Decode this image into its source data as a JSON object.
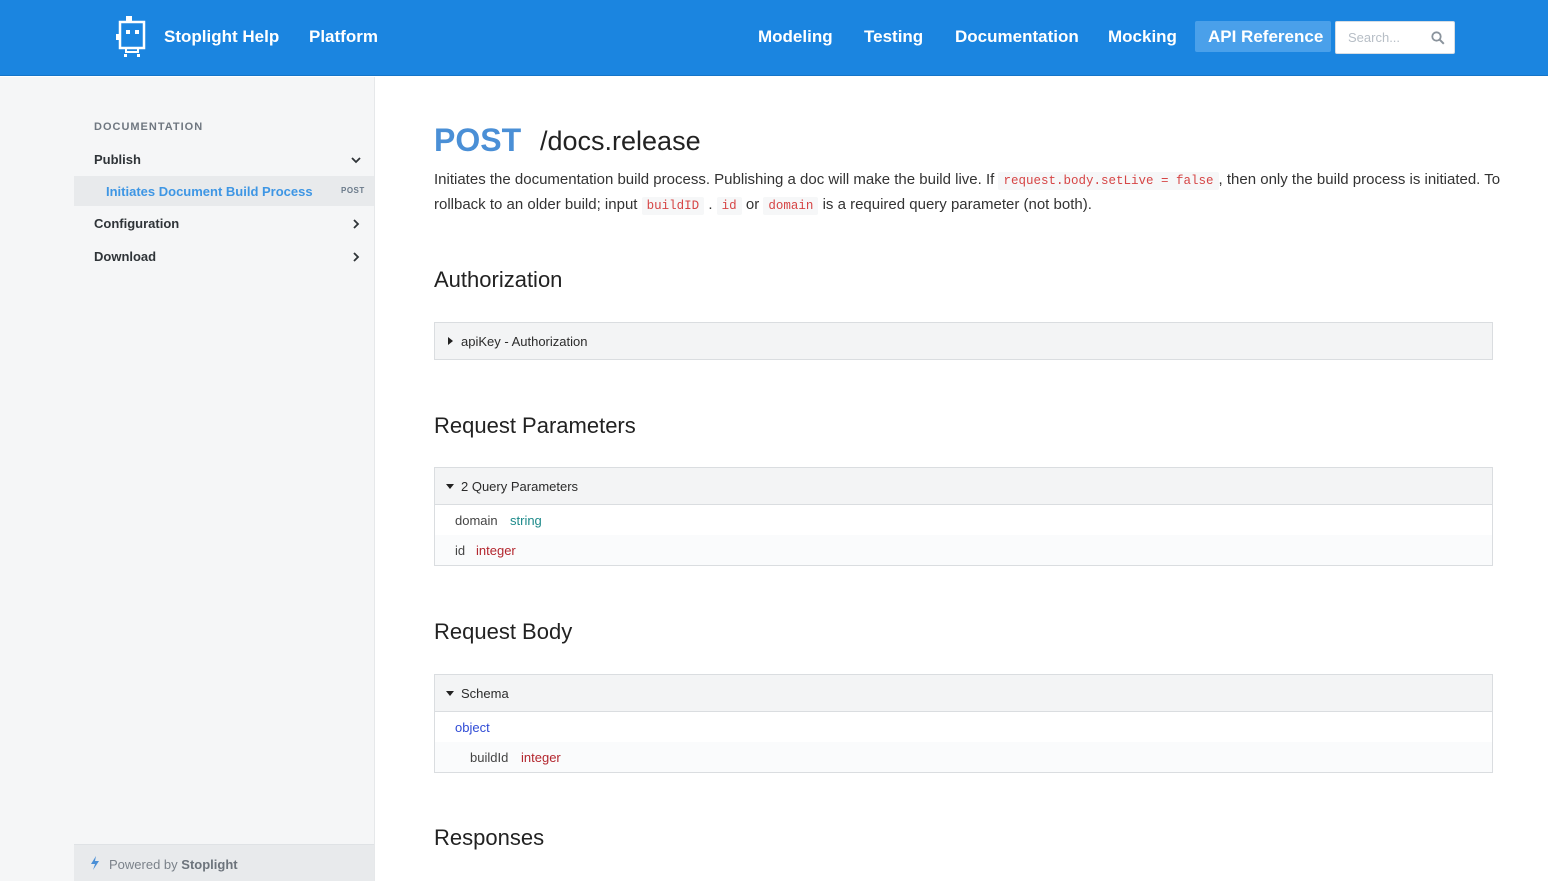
{
  "header": {
    "brand": "Stoplight Help",
    "platform": "Platform",
    "nav": [
      "Modeling",
      "Testing",
      "Documentation",
      "Mocking",
      "API Reference"
    ],
    "active_nav": "API Reference",
    "search_placeholder": "Search..."
  },
  "sidebar": {
    "section": "DOCUMENTATION",
    "items": [
      {
        "label": "Publish",
        "expanded": true
      },
      {
        "label": "Configuration",
        "expanded": false
      },
      {
        "label": "Download",
        "expanded": false
      }
    ],
    "active_sub": {
      "label": "Initiates Document Build Process",
      "method": "POST"
    },
    "powered_prefix": "Powered by",
    "powered_brand": "Stoplight"
  },
  "endpoint": {
    "method": "POST",
    "path": "/docs.release",
    "desc_1": "Initiates the documentation build process. Publishing a doc will make the build live. If",
    "code_1": "request.body.setLive = false",
    "desc_2": ", then only the build process is initiated. To rollback to an older build; input",
    "code_2": "buildID",
    "desc_3": ".",
    "code_3": "id",
    "desc_4": "or",
    "code_4": "domain",
    "desc_5": "is a required query parameter (not both)."
  },
  "authorization": {
    "heading": "Authorization",
    "panel_title": "apiKey - Authorization"
  },
  "request_params": {
    "heading": "Request Parameters",
    "panel_title": "2 Query Parameters",
    "params": [
      {
        "name": "domain",
        "type": "string"
      },
      {
        "name": "id",
        "type": "integer"
      }
    ]
  },
  "request_body": {
    "heading": "Request Body",
    "panel_title": "Schema",
    "root_type": "object",
    "fields": [
      {
        "name": "buildId",
        "type": "integer"
      }
    ]
  },
  "responses": {
    "heading": "Responses"
  },
  "colors": {
    "header_bg": "#1b85e0",
    "accent": "#3e96e4",
    "code_red": "#d64545",
    "type_string": "#1d8a8a",
    "type_integer": "#b3262e",
    "type_object": "#2f4bd6"
  }
}
